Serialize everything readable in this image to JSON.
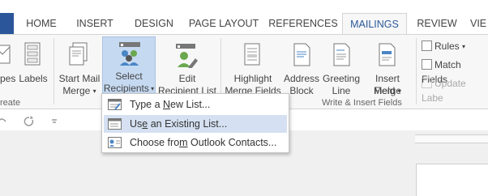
{
  "tabs": [
    "HOME",
    "INSERT",
    "DESIGN",
    "PAGE LAYOUT",
    "REFERENCES",
    "MAILINGS",
    "REVIEW",
    "VIE"
  ],
  "active_tab": "MAILINGS",
  "ribbon": {
    "envelopes": "pes",
    "labels": "Labels",
    "create_group": "reate",
    "start_mail_merge": [
      "Start Mail",
      "Merge"
    ],
    "select_recipients": [
      "Select",
      "Recipients"
    ],
    "edit_recipient_list": [
      "Edit",
      "Recipient List"
    ],
    "highlight_merge_fields": [
      "Highlight",
      "Merge Fields"
    ],
    "address_block": [
      "Address",
      "Block"
    ],
    "greeting_line": [
      "Greeting",
      "Line"
    ],
    "insert_merge_field": [
      "Insert Merge",
      "Field"
    ],
    "write_insert_group": "Write & Insert Fields",
    "rules": "Rules",
    "match_fields": "Match Fields",
    "update_labels": "Update Labe"
  },
  "menu": {
    "type_new_list": {
      "before": "Type a ",
      "key": "N",
      "after": "ew List..."
    },
    "use_existing_list": {
      "before": "Us",
      "key": "e",
      "after": " an Existing List..."
    },
    "outlook_contacts": {
      "before": "Choose fro",
      "key": "m",
      "after": " Outlook Contacts..."
    }
  },
  "colors": {
    "accent": "#2b579a",
    "highlight": "#d5e1f2",
    "selected": "#c5d9f1"
  }
}
